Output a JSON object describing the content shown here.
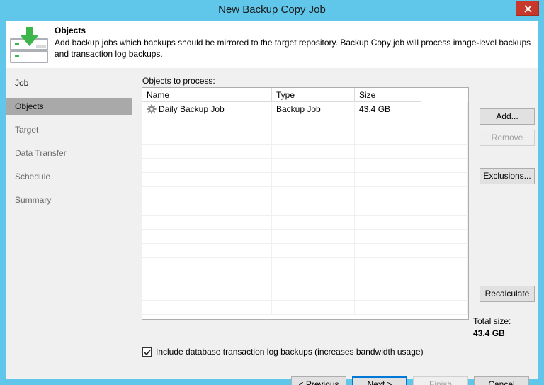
{
  "window": {
    "title": "New Backup Copy Job"
  },
  "header": {
    "title": "Objects",
    "description": "Add backup jobs which backups should be mirrored to the target repository. Backup Copy job will process image-level backups and transaction log backups.",
    "icon": "backup-copy-download-icon"
  },
  "sidebar": {
    "items": [
      {
        "label": "Job",
        "active": false
      },
      {
        "label": "Objects",
        "active": true
      },
      {
        "label": "Target",
        "active": false
      },
      {
        "label": "Data Transfer",
        "active": false
      },
      {
        "label": "Schedule",
        "active": false
      },
      {
        "label": "Summary",
        "active": false
      }
    ]
  },
  "objects": {
    "label": "Objects to process:",
    "columns": [
      "Name",
      "Type",
      "Size"
    ],
    "rows": [
      {
        "icon": "gear-icon",
        "name": "Daily Backup Job",
        "type": "Backup Job",
        "size": "43.4 GB"
      }
    ]
  },
  "side_buttons": {
    "add": "Add...",
    "remove": "Remove",
    "exclusions": "Exclusions...",
    "recalculate": "Recalculate"
  },
  "total": {
    "label": "Total size:",
    "value": "43.4 GB"
  },
  "option": {
    "checked": true,
    "label": "Include database transaction log backups (increases bandwidth usage)"
  },
  "footer": {
    "previous": "< Previous",
    "next": "Next >",
    "finish": "Finish",
    "cancel": "Cancel"
  },
  "colors": {
    "window_frame": "#60c6ea",
    "close_button": "#c7382c",
    "active_nav": "#a9a9a9",
    "icon_green": "#3cb54a"
  }
}
